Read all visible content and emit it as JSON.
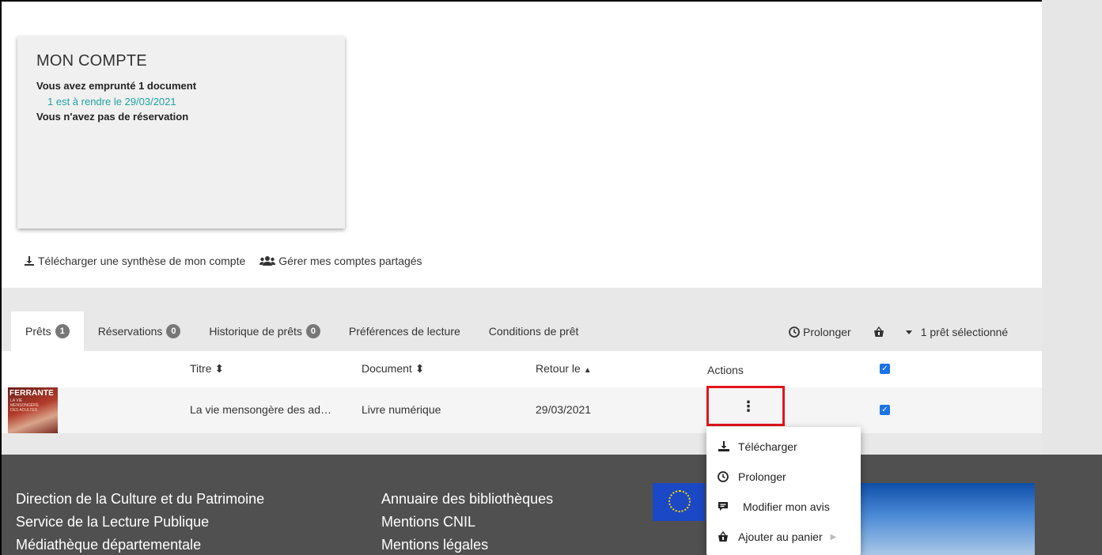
{
  "account": {
    "title": "MON COMPTE",
    "borrowed": "Vous avez emprunté 1 document",
    "due_link": "1 est à rendre le 29/03/2021",
    "reservation": "Vous n'avez pas de réservation"
  },
  "account_links": {
    "download": "Télécharger une synthèse de mon compte",
    "shared": "Gérer mes comptes partagés"
  },
  "tabs": [
    {
      "label": "Prêts",
      "count": "1"
    },
    {
      "label": "Réservations",
      "count": "0"
    },
    {
      "label": "Historique de prêts",
      "count": "0"
    },
    {
      "label": "Préférences de lecture"
    },
    {
      "label": "Conditions de prêt"
    }
  ],
  "toolbar": {
    "renew": "Prolonger",
    "selection": "1 prêt sélectionné"
  },
  "table": {
    "headers": {
      "title": "Titre",
      "document": "Document",
      "due": "Retour le",
      "actions": "Actions"
    },
    "row": {
      "cover_author": "FERRANTE",
      "cover_subtitle": "LA VIE MENSONGÈRE DES ADULTES",
      "title": "La vie mensongère des ad…",
      "document": "Livre numérique",
      "due": "29/03/2021"
    }
  },
  "menu": {
    "download": "Télécharger",
    "renew": "Prolonger",
    "review": "Modifier mon avis",
    "basket": "Ajouter au panier"
  },
  "footer": {
    "col1": [
      "Direction de la Culture et du Patrimoine",
      "Service de la Lecture Publique",
      "Médiathèque départementale"
    ],
    "col2": [
      "Annuaire des bibliothèques",
      "Mentions CNIL",
      "Mentions légales"
    ]
  },
  "colors": {
    "accent_link": "#1fa3a3",
    "highlight": "#e3141c",
    "checkbox": "#1a73e8",
    "footer_bg": "#505050"
  }
}
